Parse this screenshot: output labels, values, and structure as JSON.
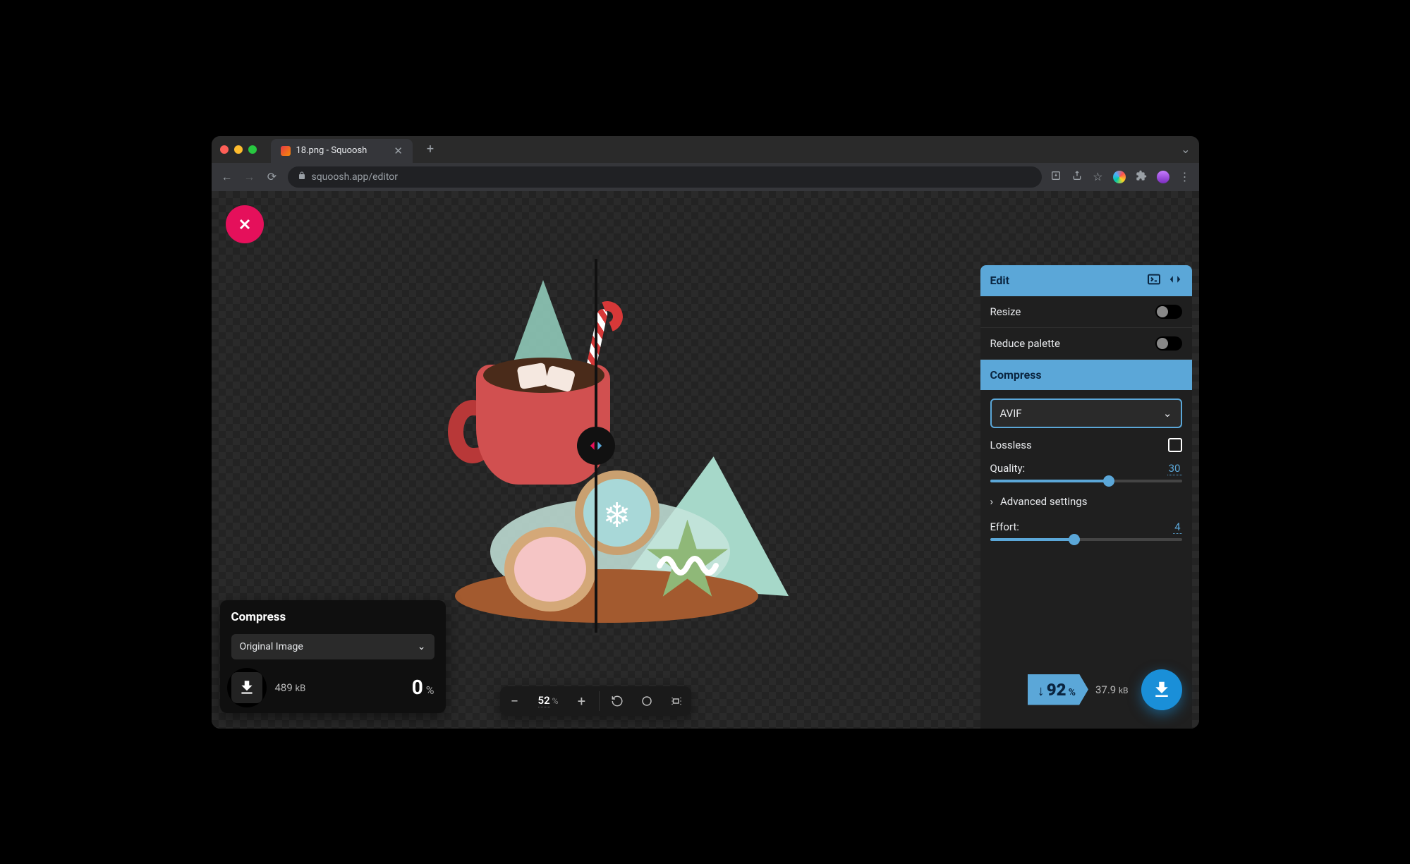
{
  "browser": {
    "tab_title": "18.png - Squoosh",
    "url": "squoosh.app/editor"
  },
  "left_panel": {
    "title": "Compress",
    "codec_selected": "Original Image",
    "filesize_value": "489",
    "filesize_unit": "kB",
    "savings_value": "0",
    "savings_unit": "%"
  },
  "right_panel": {
    "edit_header": "Edit",
    "resize_label": "Resize",
    "reduce_palette_label": "Reduce palette",
    "compress_header": "Compress",
    "codec_selected": "AVIF",
    "lossless_label": "Lossless",
    "quality_label": "Quality:",
    "quality_value": "30",
    "advanced_label": "Advanced settings",
    "effort_label": "Effort:",
    "effort_value": "4",
    "savings_value": "92",
    "savings_unit": "%",
    "filesize_value": "37.9",
    "filesize_unit": "kB"
  },
  "zoom": {
    "level": "52",
    "unit": "%"
  }
}
